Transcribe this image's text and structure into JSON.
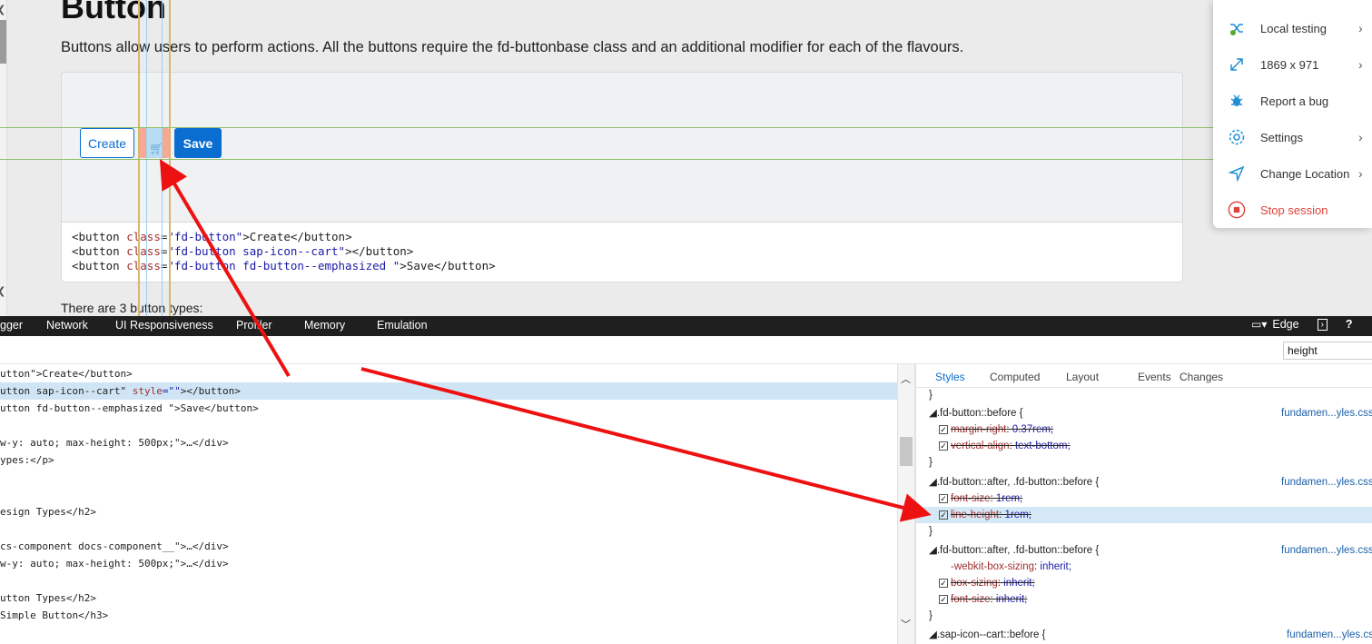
{
  "page": {
    "title": "Button",
    "description": "Buttons allow users to perform actions. All the buttons require the fd-buttonbase class and an additional modifier for each of the flavours.",
    "footer_text": "There are 3 button types:",
    "buttons": {
      "create": "Create",
      "cart_icon": "cart-icon",
      "save": "Save"
    },
    "code": [
      {
        "tag_open": "<button ",
        "attr": "class",
        "eq": "=",
        "value": "\"fd-button\"",
        "text": ">Create</button>"
      },
      {
        "tag_open": "<button ",
        "attr": "class",
        "eq": "=",
        "value": "\"fd-button sap-icon--cart\"",
        "text": "></button>"
      },
      {
        "tag_open": "<button ",
        "attr": "class",
        "eq": "=",
        "value": "\"fd-button fd-button--emphasized \"",
        "text": ">Save</button>"
      }
    ]
  },
  "side_menu": {
    "items": [
      {
        "label": "Local testing",
        "icon": "shuffle-icon",
        "chevron": "›"
      },
      {
        "label": "1869 x 971",
        "icon": "expand-icon",
        "chevron": "›"
      },
      {
        "label": "Report a bug",
        "icon": "bug-icon",
        "chevron": ""
      },
      {
        "label": "Settings",
        "icon": "gear-icon",
        "chevron": "›"
      },
      {
        "label": "Change Location",
        "icon": "location-icon",
        "chevron": "›"
      },
      {
        "label": "Stop session",
        "icon": "stop-icon",
        "chevron": ""
      }
    ],
    "stop_color": "#e0413a",
    "icon_color": "#1f8fd6"
  },
  "devtools": {
    "tabs": [
      "gger",
      "Network",
      "UI Responsiveness",
      "Profiler",
      "Memory",
      "Emulation"
    ],
    "browser_label": "Edge",
    "help": "?",
    "search_value": "height",
    "dom_lines": [
      {
        "pre": "utton\">Create</button>",
        "attr": "",
        "val": "",
        "post": "",
        "selected": false
      },
      {
        "pre": "utton sap-icon--cart\" ",
        "attr": "style",
        "val": "=\"\"",
        "post": "></button>",
        "selected": true
      },
      {
        "pre": "utton fd-button--emphasized \">Save</button>",
        "attr": "",
        "val": "",
        "post": "",
        "selected": false
      },
      {
        "pre": "",
        "attr": "",
        "val": "",
        "post": "",
        "selected": false
      },
      {
        "pre": "w-y: auto; max-height: 500px;\">…</div>",
        "attr": "",
        "val": "",
        "post": "",
        "selected": false
      },
      {
        "pre": "ypes:</p>",
        "attr": "",
        "val": "",
        "post": "",
        "selected": false
      },
      {
        "pre": "",
        "attr": "",
        "val": "",
        "post": "",
        "selected": false
      },
      {
        "pre": "",
        "attr": "",
        "val": "",
        "post": "",
        "selected": false
      },
      {
        "pre": "esign Types</h2>",
        "attr": "",
        "val": "",
        "post": "",
        "selected": false
      },
      {
        "pre": "",
        "attr": "",
        "val": "",
        "post": "",
        "selected": false
      },
      {
        "pre": "cs-component docs-component__\">…</div>",
        "attr": "",
        "val": "",
        "post": "",
        "selected": false
      },
      {
        "pre": "w-y: auto; max-height: 500px;\">…</div>",
        "attr": "",
        "val": "",
        "post": "",
        "selected": false
      },
      {
        "pre": "",
        "attr": "",
        "val": "",
        "post": "",
        "selected": false
      },
      {
        "pre": "utton Types</h2>",
        "attr": "",
        "val": "",
        "post": "",
        "selected": false
      },
      {
        "pre": "Simple Button</h3>",
        "attr": "",
        "val": "",
        "post": "",
        "selected": false
      }
    ],
    "styles_tabs": [
      "Styles",
      "Computed",
      "Layout",
      "Events",
      "Changes"
    ],
    "styles_rules": [
      {
        "kind": "brace",
        "text": "}"
      },
      {
        "kind": "selector",
        "text": "◢.fd-button::before   {",
        "src": "fundamen...yles.css"
      },
      {
        "kind": "prop",
        "name": "margin-right",
        "value": "0.37rem;",
        "strike": true,
        "checked": true
      },
      {
        "kind": "prop",
        "name": "vertical-align",
        "value": "text-bottom;",
        "strike": true,
        "checked": true
      },
      {
        "kind": "brace",
        "text": "}"
      },
      {
        "kind": "selector",
        "text": "◢.fd-button::after, .fd-button::before   {",
        "src": "fundamen...yles.css"
      },
      {
        "kind": "prop",
        "name": "font-size",
        "value": "1rem;",
        "strike": true,
        "checked": true
      },
      {
        "kind": "prop",
        "name": "line-height",
        "value": "1rem;",
        "strike": true,
        "checked": true,
        "highlight": true
      },
      {
        "kind": "brace",
        "text": "}"
      },
      {
        "kind": "selector",
        "text": "◢.fd-button::after, .fd-button::before   {",
        "src": "fundamen...yles.css"
      },
      {
        "kind": "prop",
        "name": "-webkit-box-sizing",
        "value": "inherit;",
        "strike": false,
        "checked": false
      },
      {
        "kind": "prop",
        "name": "box-sizing",
        "value": "inherit;",
        "strike": true,
        "checked": true
      },
      {
        "kind": "prop",
        "name": "font-size",
        "value": "inherit;",
        "strike": true,
        "checked": true
      },
      {
        "kind": "brace",
        "text": "}"
      },
      {
        "kind": "selector",
        "text": "◢.sap-icon--cart::before   {",
        "src": "fundamen...yles.css"
      }
    ]
  },
  "colors": {
    "accent": "#0a6ed1",
    "annotation_red": "#ee1111"
  }
}
